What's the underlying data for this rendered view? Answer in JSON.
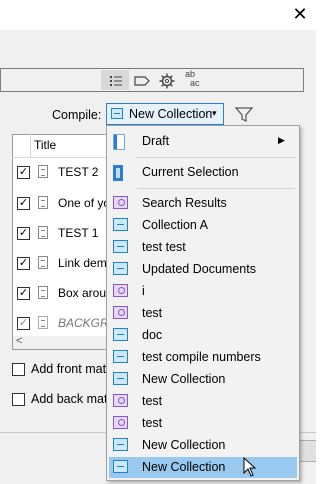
{
  "window": {
    "close_glyph": "✕"
  },
  "toolbar": {
    "icons": [
      "list-icon",
      "tag-icon",
      "gear-icon",
      "abac-icon"
    ],
    "abac_top": "ab",
    "abac_bottom": "ac"
  },
  "compile": {
    "label": "Compile:",
    "selected": "New Collection",
    "caret": "▾"
  },
  "contents": {
    "column_title": "Title",
    "rows": [
      {
        "checked": true,
        "title": "TEST 2",
        "italic": false
      },
      {
        "checked": true,
        "title": "One of yo",
        "italic": false
      },
      {
        "checked": true,
        "title": "TEST 1",
        "italic": false
      },
      {
        "checked": true,
        "title": "Link dem",
        "italic": false
      },
      {
        "checked": true,
        "title": "Box arou",
        "italic": false
      },
      {
        "checked": true,
        "title": "BACKGRO",
        "italic": true
      }
    ],
    "scroll_left": "<"
  },
  "options": {
    "front_matter": "Add front mat",
    "back_matter": "Add back mat"
  },
  "menu": {
    "items": [
      {
        "label": "Draft",
        "icon": "draft-icon",
        "submenu": true,
        "arrow": "▶"
      },
      {
        "label": "Current Selection",
        "icon": "current-selection-icon"
      },
      {
        "label": "Search Results",
        "icon": "search-collection-icon"
      },
      {
        "label": "Collection A",
        "icon": "collection-icon"
      },
      {
        "label": "test test",
        "icon": "collection-icon"
      },
      {
        "label": "Updated Documents",
        "icon": "collection-icon"
      },
      {
        "label": "i",
        "icon": "search-collection-icon"
      },
      {
        "label": "test",
        "icon": "search-collection-icon"
      },
      {
        "label": "doc",
        "icon": "collection-icon"
      },
      {
        "label": "test compile numbers",
        "icon": "collection-icon"
      },
      {
        "label": "New Collection",
        "icon": "collection-icon"
      },
      {
        "label": "test",
        "icon": "search-collection-icon"
      },
      {
        "label": "test",
        "icon": "search-collection-icon"
      },
      {
        "label": "New Collection",
        "icon": "collection-icon"
      },
      {
        "label": "New Collection",
        "icon": "collection-icon",
        "highlighted": true
      }
    ]
  },
  "colors": {
    "highlight": "#99c9ef",
    "accent": "#1a85c8",
    "search_accent": "#8a55c9"
  }
}
